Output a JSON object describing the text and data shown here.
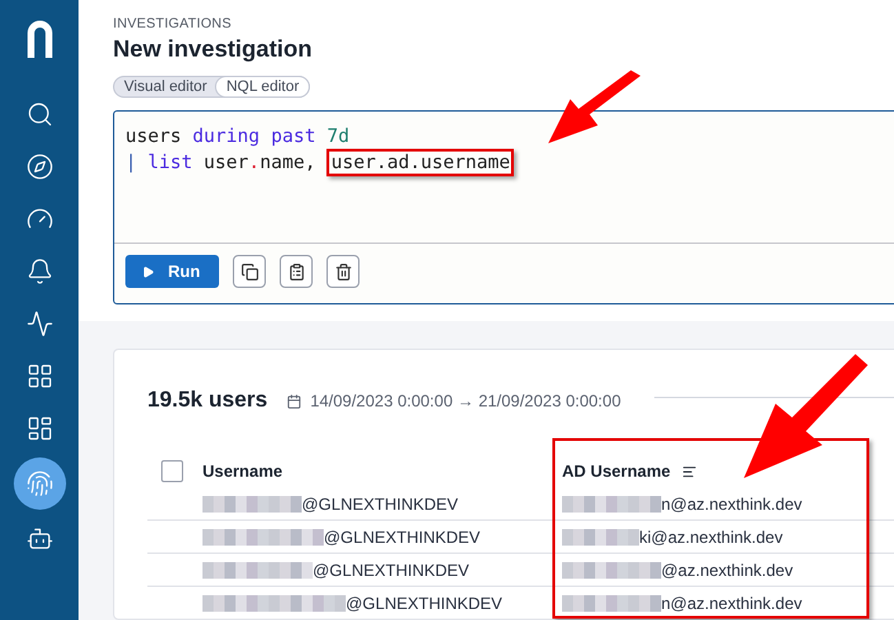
{
  "sidebar": {
    "items": [
      {
        "selected": false
      },
      {
        "selected": false
      },
      {
        "selected": false
      },
      {
        "selected": false
      },
      {
        "selected": false
      },
      {
        "selected": false
      },
      {
        "selected": false
      },
      {
        "selected": true
      },
      {
        "selected": false
      }
    ]
  },
  "header": {
    "breadcrumb": "INVESTIGATIONS",
    "title": "New investigation"
  },
  "editor_toggle": [
    {
      "label": "Visual editor",
      "selected": false
    },
    {
      "label": "NQL editor",
      "selected": true
    }
  ],
  "editor": {
    "lines": [
      [
        {
          "text": "users ",
          "kind": "plain"
        },
        {
          "text": "during ",
          "kind": "keyword"
        },
        {
          "text": "past ",
          "kind": "keyword"
        },
        {
          "text": "7d",
          "kind": "number"
        }
      ],
      [
        {
          "text": "| ",
          "kind": "pipe"
        },
        {
          "text": "list ",
          "kind": "keyword"
        },
        {
          "text": "user",
          "kind": "plain"
        },
        {
          "text": ".",
          "kind": "op"
        },
        {
          "text": "name, ",
          "kind": "plain"
        },
        {
          "text": "user.ad.username",
          "kind": "highlight"
        }
      ]
    ],
    "run_button": "Run"
  },
  "results": {
    "count": "19.5k users",
    "date_from": "14/09/2023 0:00:00",
    "arrow": "→",
    "date_to": "21/09/2023 0:00:00",
    "select_all": {
      "checked": false
    },
    "columns": [
      "Username",
      "AD Username"
    ],
    "rows": [
      {
        "username": "@GLNEXTHINKDEV",
        "ad_username": "n@az.nexthink.dev"
      },
      {
        "username": "@GLNEXTHINKDEV",
        "ad_username": "ki@az.nexthink.dev"
      },
      {
        "username": "@GLNEXTHINKDEV",
        "ad_username": "@az.nexthink.dev"
      },
      {
        "username": "@GLNEXTHINKDEV",
        "ad_username": "n@az.nexthink.dev"
      }
    ]
  }
}
